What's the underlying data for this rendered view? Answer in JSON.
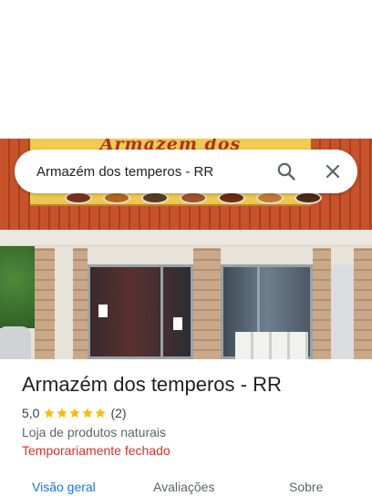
{
  "search": {
    "query": "Armazém dos temperos - RR",
    "search_icon": "search-icon",
    "close_icon": "close-icon"
  },
  "photo": {
    "sign_text": "Armazém dos"
  },
  "place": {
    "name": "Armazém dos temperos - RR",
    "rating": "5,0",
    "rating_stars": 5,
    "review_count": "(2)",
    "category": "Loja de produtos naturais",
    "status": "Temporariamente fechado"
  },
  "tabs": [
    {
      "label": "Visão geral",
      "active": true
    },
    {
      "label": "Avaliações",
      "active": false
    },
    {
      "label": "Sobre",
      "active": false
    }
  ],
  "colors": {
    "accent": "#1a73e8",
    "status_closed": "#d93025",
    "star": "#fbbc04"
  }
}
